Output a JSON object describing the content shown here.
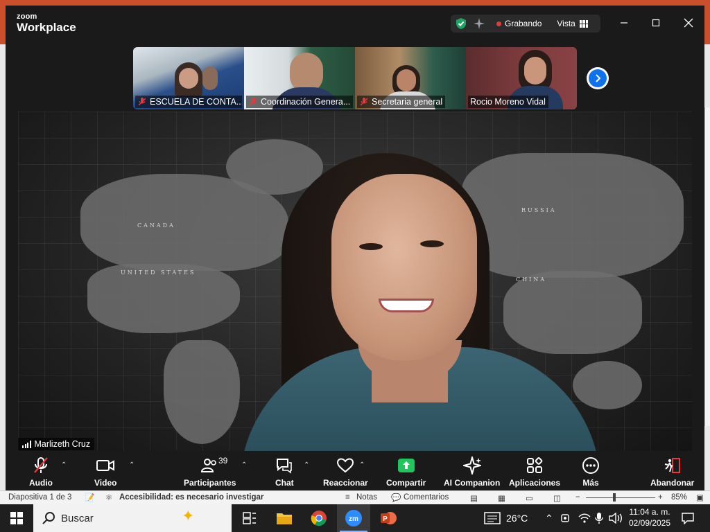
{
  "app": {
    "brand_small": "zoom",
    "brand_big": "Workplace"
  },
  "titlebar": {
    "recording_label": "Grabando",
    "view_label": "Vista",
    "colors": {
      "secure": "#21a366",
      "recording_dot": "#e5393c"
    }
  },
  "participants_strip": [
    {
      "name": "ESCUELA DE CONTA...",
      "muted": true
    },
    {
      "name": "Coordinación Genera...",
      "muted": true
    },
    {
      "name": "Secretaria general",
      "muted": true
    },
    {
      "name": "Rocio Moreno Vidal",
      "muted": false
    }
  ],
  "main_speaker": {
    "name": "Marlizeth Cruz"
  },
  "map_labels": [
    "CANADA",
    "UNITED STATES",
    "RUSSIA",
    "CHINA"
  ],
  "toolbar": {
    "audio": "Audio",
    "video": "Video",
    "participants": "Participantes",
    "participants_count": "39",
    "chat": "Chat",
    "react": "Reaccionar",
    "share": "Compartir",
    "ai": "AI Companion",
    "apps": "Aplicaciones",
    "more": "Más",
    "leave": "Abandonar",
    "colors": {
      "share": "#21c45d",
      "leave": "#e5393c"
    }
  },
  "ppt_status": {
    "slide": "Diapositiva 1 de 3",
    "accessibility": "Accesibilidad: es necesario investigar",
    "notes": "Notas",
    "comments": "Comentarios",
    "zoom": "85%"
  },
  "taskbar": {
    "search_placeholder": "Buscar",
    "temperature": "26°C",
    "time": "11:04 a. m.",
    "date": "02/09/2025",
    "apps": [
      "windows-start",
      "task-view",
      "file-explorer",
      "chrome",
      "zoom",
      "powerpoint"
    ]
  }
}
